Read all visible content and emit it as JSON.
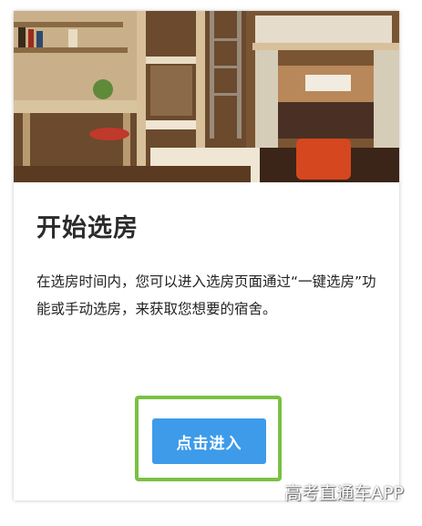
{
  "card": {
    "title": "开始选房",
    "description": "在选房时间内，您可以进入选房页面通过“一键选房”功能或手动选房，来获取您想要的宿舍。",
    "enter_button_label": "点击进入",
    "hero_image_icon": "dorm-room-photo"
  },
  "watermark": {
    "text": "高考直通车APP"
  },
  "colors": {
    "button": "#3d9be9",
    "highlight_border": "#7ac143",
    "title": "#2b2b2b"
  }
}
